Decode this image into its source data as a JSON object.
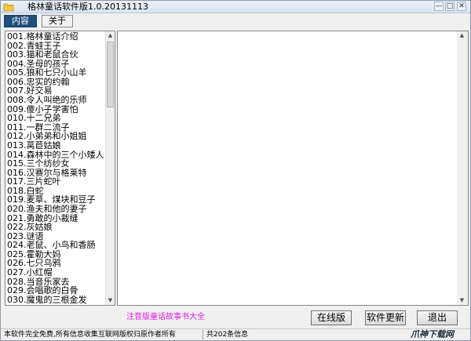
{
  "window": {
    "title": "格林童话软件版1.0.20131113",
    "minimize_glyph": "—",
    "maximize_glyph": "□",
    "close_glyph": "✕"
  },
  "tabs": [
    {
      "label": "内容",
      "active": true
    },
    {
      "label": "关于",
      "active": false
    }
  ],
  "story_list": [
    "001.格林童话介绍",
    "002.青蛙王子",
    "003.猫和老鼠合伙",
    "004.圣母的孩子",
    "005.狼和七只小山羊",
    "006.忠实的约翰",
    "007.好交易",
    "008.令人叫绝的乐师",
    "009.傻小子学害怕",
    "010.十二兄弟",
    "011.一群二流子",
    "012.小弟弟和小姐姐",
    "013.莴苣姑娘",
    "014.森林中的三个小矮人",
    "015.三个纺纱女",
    "016.汉赛尔与格莱特",
    "017.三片蛇叶",
    "018.白蛇",
    "019.麦草、煤块和豆子",
    "020.渔夫和他的妻子",
    "021.勇敢的小裁缝",
    "022.灰姑娘",
    "023.谜语",
    "024.老鼠、小鸟和香肠",
    "025.霍勒大妈",
    "026.七只乌鸦",
    "027.小红帽",
    "028.当音乐家去",
    "029.会唱歌的白骨",
    "030.魔鬼的三根金发"
  ],
  "scroll_glyphs": {
    "up": "▲",
    "down": "▼"
  },
  "footer": {
    "promo_link": "注音版童话故事书大全",
    "online_button": "在线版",
    "update_button": "软件更新",
    "exit_button": "退出"
  },
  "status_bar": {
    "notice": "本软件完全免费,所有信息收集互联网版权归原作者所有",
    "count": "共202条信息"
  },
  "watermark": "爪神下载网",
  "colors": {
    "active_tab_bg": "#1f4f7d",
    "promo_link": "#e01fe0",
    "window_bg": "#f0f0f0"
  },
  "icons": {
    "app": "folder-icon"
  }
}
